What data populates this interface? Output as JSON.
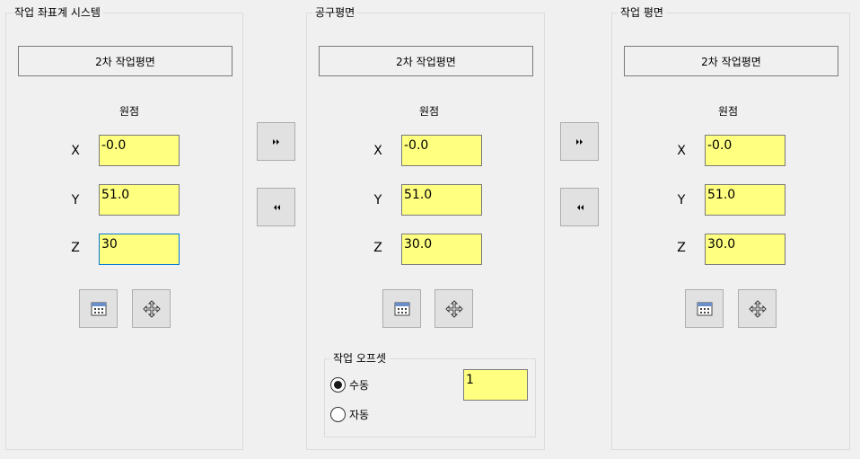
{
  "panels": [
    {
      "title": "작업 좌표계 시스템",
      "plane_button": "2차 작업평면",
      "origin_label": "원점",
      "axes": [
        {
          "label": "X",
          "value": "-0.0"
        },
        {
          "label": "Y",
          "value": "51.0"
        },
        {
          "label": "Z",
          "value": "30"
        }
      ],
      "icons": [
        "calculator-icon",
        "move-icon"
      ]
    },
    {
      "title": "공구평면",
      "plane_button": "2차 작업평면",
      "origin_label": "원점",
      "axes": [
        {
          "label": "X",
          "value": "-0.0"
        },
        {
          "label": "Y",
          "value": "51.0"
        },
        {
          "label": "Z",
          "value": "30.0"
        }
      ],
      "icons": [
        "calculator-icon",
        "move-icon"
      ]
    },
    {
      "title": "작업 평면",
      "plane_button": "2차 작업평면",
      "origin_label": "원점",
      "axes": [
        {
          "label": "X",
          "value": "-0.0"
        },
        {
          "label": "Y",
          "value": "51.0"
        },
        {
          "label": "Z",
          "value": "30.0"
        }
      ],
      "icons": [
        "calculator-icon",
        "move-icon"
      ]
    }
  ],
  "transfer_buttons": {
    "forward_icon": "double-right-arrow-icon",
    "back_icon": "double-left-arrow-icon"
  },
  "work_offset": {
    "title": "작업 오프셋",
    "options": [
      {
        "label": "수동",
        "selected": true
      },
      {
        "label": "자동",
        "selected": false
      }
    ],
    "value": "1"
  },
  "colors": {
    "field_bg": "#ffff80",
    "window_bg": "#f0f0f0",
    "focus_border": "#0078d7"
  }
}
